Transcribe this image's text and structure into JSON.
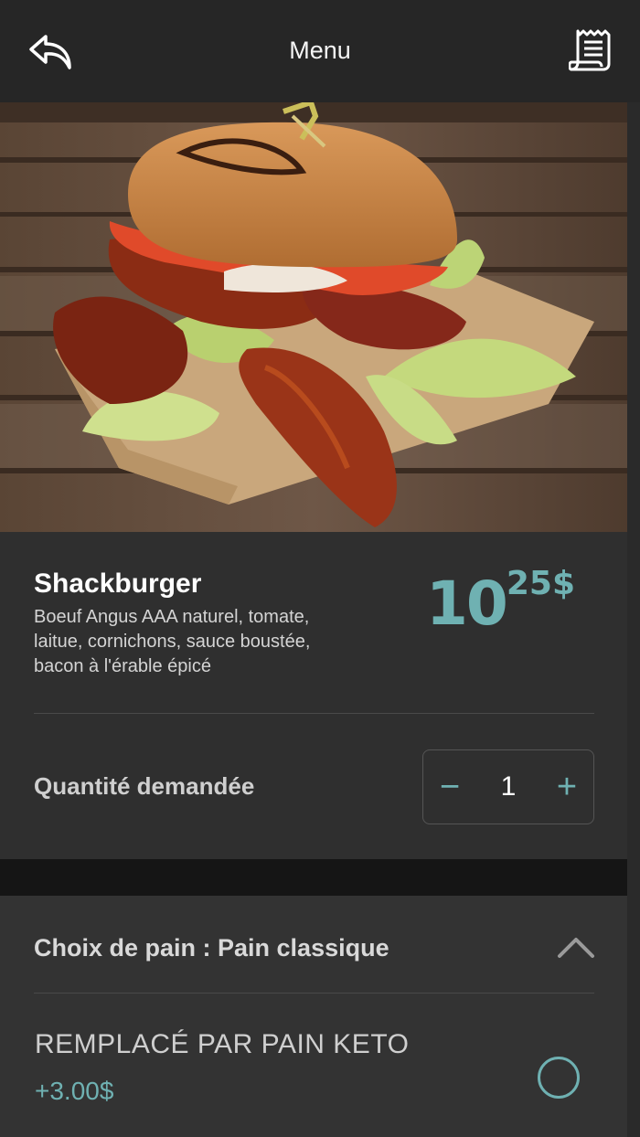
{
  "header": {
    "title": "Menu",
    "back_icon": "back-arrow-icon",
    "receipt_icon": "receipt-icon"
  },
  "product": {
    "name": "Shackburger",
    "description": " Boeuf Angus AAA naturel, tomate, laitue, cornichons, sauce boustée, bacon à l'érable épicé",
    "price_major": "10",
    "price_minor": "25",
    "price_currency": "$"
  },
  "quantity": {
    "label": "Quantité demandée",
    "value": "1",
    "minus": "−",
    "plus": "+"
  },
  "options": {
    "header": "Choix de pain : Pain classique",
    "items": [
      {
        "label": "REMPLACÉ PAR PAIN KETO",
        "price": "+3.00$",
        "selected": false
      }
    ]
  },
  "colors": {
    "accent": "#6fb1b2",
    "header_bg": "#262626",
    "body_bg": "#2f2f2f"
  }
}
